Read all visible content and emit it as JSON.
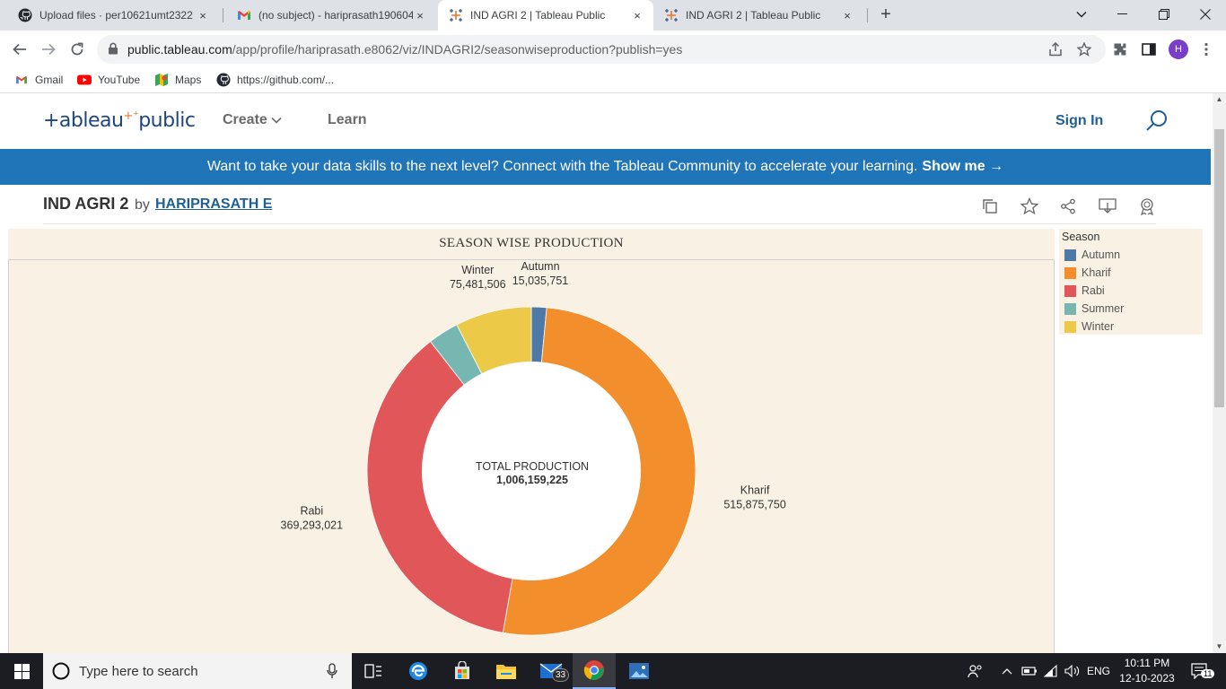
{
  "browser": {
    "tabs": [
      {
        "title": "Upload files · per10621umt2322",
        "icon": "github-icon",
        "active": false
      },
      {
        "title": "(no subject) - hariprasath190604",
        "icon": "gmail-icon",
        "active": false
      },
      {
        "title": "IND AGRI 2 | Tableau Public",
        "icon": "tableau-icon",
        "active": true
      },
      {
        "title": "IND AGRI 2 | Tableau Public",
        "icon": "tableau-icon",
        "active": false
      }
    ],
    "tab_close": "×",
    "new_tab": "+",
    "url_host": "public.tableau.com",
    "url_path": "/app/profile/hariprasath.e8062/viz/INDAGRI2/seasonwiseproduction?publish=yes",
    "profile_initial": "H",
    "bookmarks": [
      {
        "label": "Gmail",
        "icon": "gmail-icon"
      },
      {
        "label": "YouTube",
        "icon": "youtube-icon"
      },
      {
        "label": "Maps",
        "icon": "maps-icon"
      },
      {
        "label": "https://github.com/...",
        "icon": "github-icon"
      }
    ]
  },
  "site": {
    "logo": "+ableau",
    "logo_public": "public",
    "nav": {
      "create": "Create",
      "learn": "Learn"
    },
    "sign_in": "Sign In",
    "banner_text": "Want to take your data skills to the next level? Connect with the Tableau Community to accelerate your learning.",
    "banner_cta": "Show me →"
  },
  "viz": {
    "title": "IND AGRI 2",
    "by": "by",
    "author": "HARIPRASATH E"
  },
  "dashboard": {
    "title": "SEASON WISE PRODUCTION"
  },
  "chart_data": {
    "type": "pie",
    "variant": "donut",
    "title": "SEASON WISE PRODUCTION",
    "center_label": "TOTAL PRODUCTION",
    "center_value": "1,006,159,225",
    "slices": [
      {
        "label": "Autumn",
        "value": 15035751,
        "display": "15,035,751",
        "color": "#4e79a7"
      },
      {
        "label": "Kharif",
        "value": 515875750,
        "display": "515,875,750",
        "color": "#f28e2b"
      },
      {
        "label": "Rabi",
        "value": 369293021,
        "display": "369,293,021",
        "color": "#e15759"
      },
      {
        "label": "Summer",
        "value": 30473197,
        "display": "",
        "color": "#76b7b2"
      },
      {
        "label": "Winter",
        "value": 75481506,
        "display": "75,481,506",
        "color": "#edc948"
      }
    ],
    "legend_title": "Season",
    "legend_placement": "right"
  },
  "legend": {
    "title": "Season",
    "items": [
      {
        "label": "Autumn",
        "color": "#4e79a7"
      },
      {
        "label": "Kharif",
        "color": "#f28e2b"
      },
      {
        "label": "Rabi",
        "color": "#e15759"
      },
      {
        "label": "Summer",
        "color": "#76b7b2"
      },
      {
        "label": "Winter",
        "color": "#edc948"
      }
    ]
  },
  "taskbar": {
    "search_placeholder": "Type here to search",
    "mail_badge": "33",
    "language": "ENG",
    "time": "10:11 PM",
    "date": "12-10-2023",
    "notification_count": "11"
  }
}
